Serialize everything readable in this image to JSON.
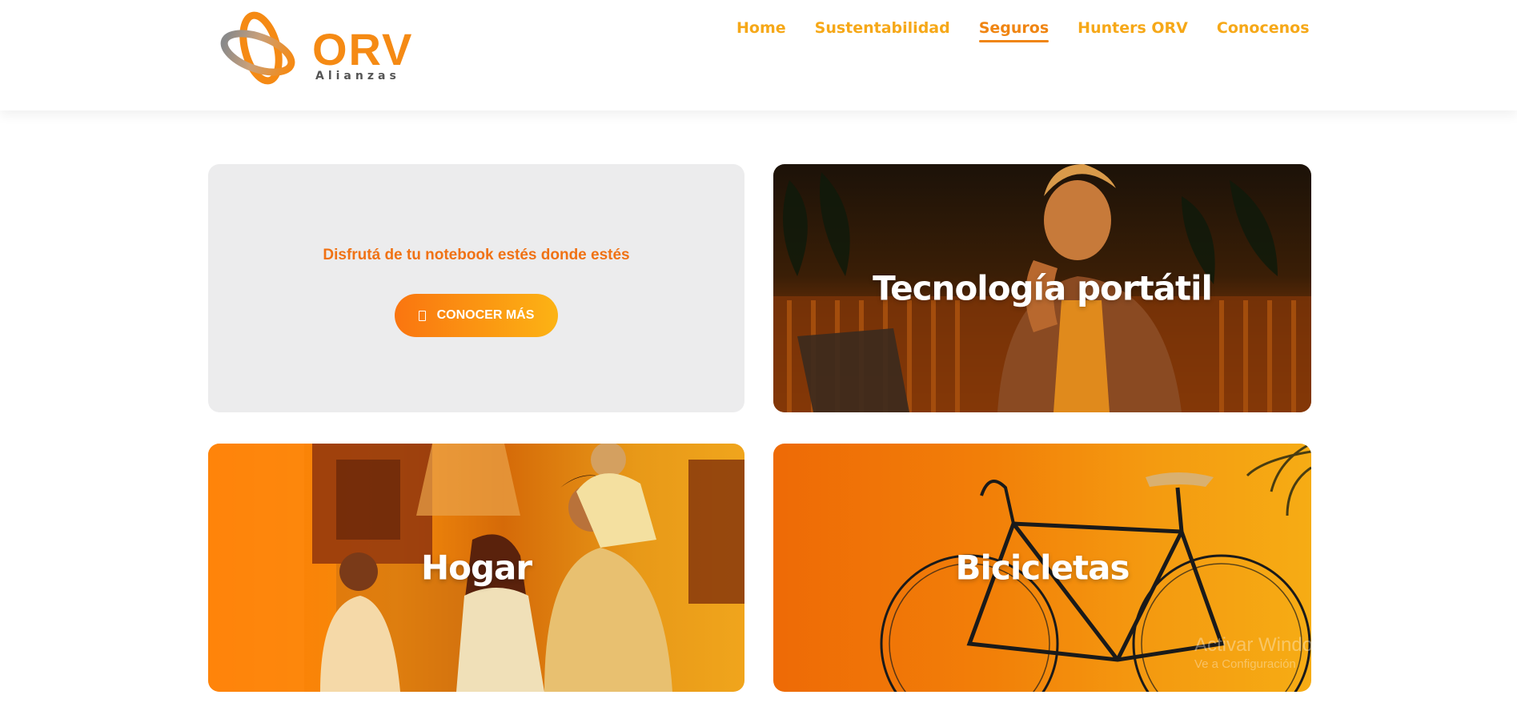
{
  "brand": {
    "name": "ORV",
    "tagline": "Alianzas",
    "colors": {
      "primary": "#f08512",
      "nav": "#f6a818",
      "gradient_start": "#fa7510",
      "gradient_end": "#fcb314"
    }
  },
  "nav": {
    "items": [
      {
        "label": "Home",
        "active": false
      },
      {
        "label": "Sustentabilidad",
        "active": false
      },
      {
        "label": "Seguros",
        "active": true
      },
      {
        "label": "Hunters ORV",
        "active": false
      },
      {
        "label": "Conocenos",
        "active": false
      }
    ]
  },
  "promo": {
    "text": "Disfrutá de tu notebook estés donde estés",
    "button_label": "CONOCER MÁS",
    "button_icon": "mobile-icon"
  },
  "cards": [
    {
      "title": "Tecnología portátil",
      "image": "man-on-phone-with-laptop-photo"
    },
    {
      "title": "Hogar",
      "image": "family-cooking-in-kitchen-photo"
    },
    {
      "title": "Bicicletas",
      "image": "bicycle-against-wall-photo"
    }
  ],
  "watermark": {
    "line1": "Activar Windows",
    "line2": "Ve a Configuración"
  }
}
